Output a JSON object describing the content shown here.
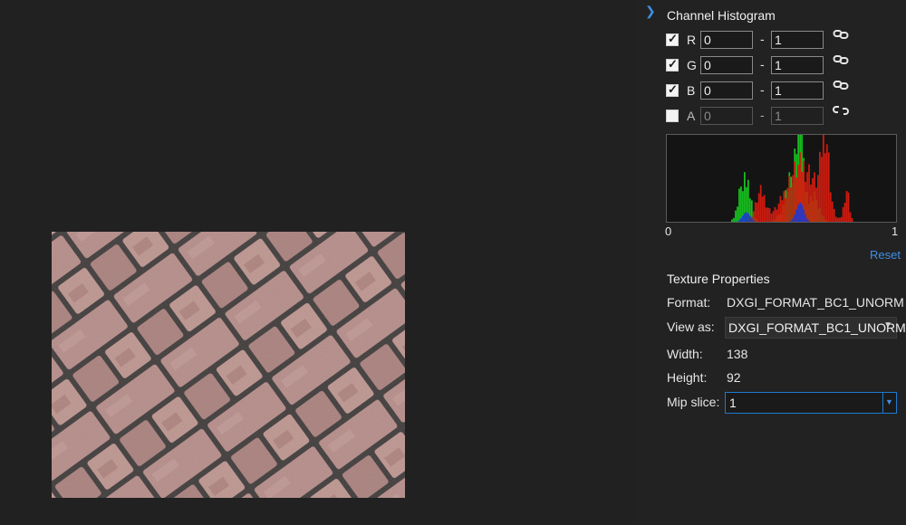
{
  "histogram": {
    "title": "Channel Histogram",
    "axis_min": "0",
    "axis_max": "1",
    "reset_label": "Reset",
    "channels": [
      {
        "letter": "R",
        "enabled": true,
        "min": "0",
        "max": "1",
        "linked": true
      },
      {
        "letter": "G",
        "enabled": true,
        "min": "0",
        "max": "1",
        "linked": true
      },
      {
        "letter": "B",
        "enabled": true,
        "min": "0",
        "max": "1",
        "linked": true
      },
      {
        "letter": "A",
        "enabled": false,
        "min": "0",
        "max": "1",
        "linked": false
      }
    ],
    "colors": {
      "red": "#d81b0f",
      "green": "#18d021",
      "blue": "#1b36d8"
    }
  },
  "texture_properties": {
    "title": "Texture Properties",
    "format_label": "Format:",
    "format_value": "DXGI_FORMAT_BC1_UNORM",
    "view_as_label": "View as:",
    "view_as_value": "DXGI_FORMAT_BC1_UNORM",
    "width_label": "Width:",
    "width_value": "138",
    "height_label": "Height:",
    "height_value": "92",
    "mip_slice_label": "Mip slice:",
    "mip_slice_value": "1"
  },
  "icons": {
    "expand": "chevron-right-icon",
    "link": "link-icon",
    "unlink": "unlink-icon",
    "dropdown": "chevron-down-icon"
  },
  "accent_color": "#3f8fe6"
}
